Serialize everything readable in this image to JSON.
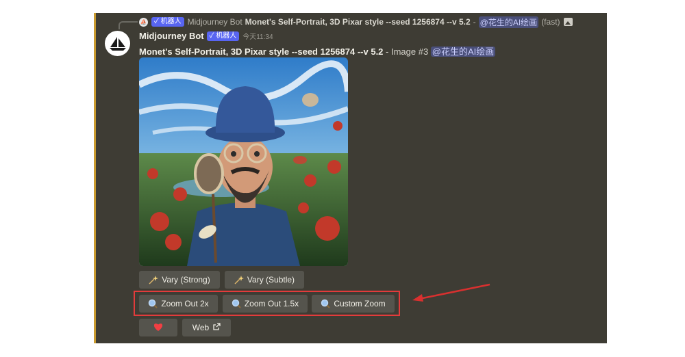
{
  "reply": {
    "bot_tag": "✓ 机器人",
    "author": "Midjourney Bot",
    "prompt": "Monet's Self-Portrait, 3D Pixar style --seed 1256874 --v 5.2",
    "separator": "-",
    "mention": "@花生的AI绘画",
    "mode": "(fast)"
  },
  "message": {
    "username": "Midjourney Bot",
    "bot_tag": "✓ 机器人",
    "timestamp": "今天11:34",
    "prompt": "Monet's Self-Portrait, 3D Pixar style --seed 1256874 --v 5.2",
    "image_label": " - Image #3 ",
    "mention": "@花生的AI绘画"
  },
  "buttons": {
    "vary_strong": "Vary (Strong)",
    "vary_subtle": "Vary (Subtle)",
    "zoom_2x": "Zoom Out 2x",
    "zoom_15x": "Zoom Out 1.5x",
    "custom_zoom": "Custom Zoom",
    "web": "Web"
  },
  "colors": {
    "panel_bg": "#3e3c34",
    "button_bg": "#55544d",
    "bot_tag": "#5865f2",
    "highlight": "#e33b3b",
    "heart": "#f23f43"
  },
  "icons": [
    "sparkle-icon",
    "magnifier-icon",
    "heart-icon",
    "external-link-icon",
    "image-icon"
  ]
}
